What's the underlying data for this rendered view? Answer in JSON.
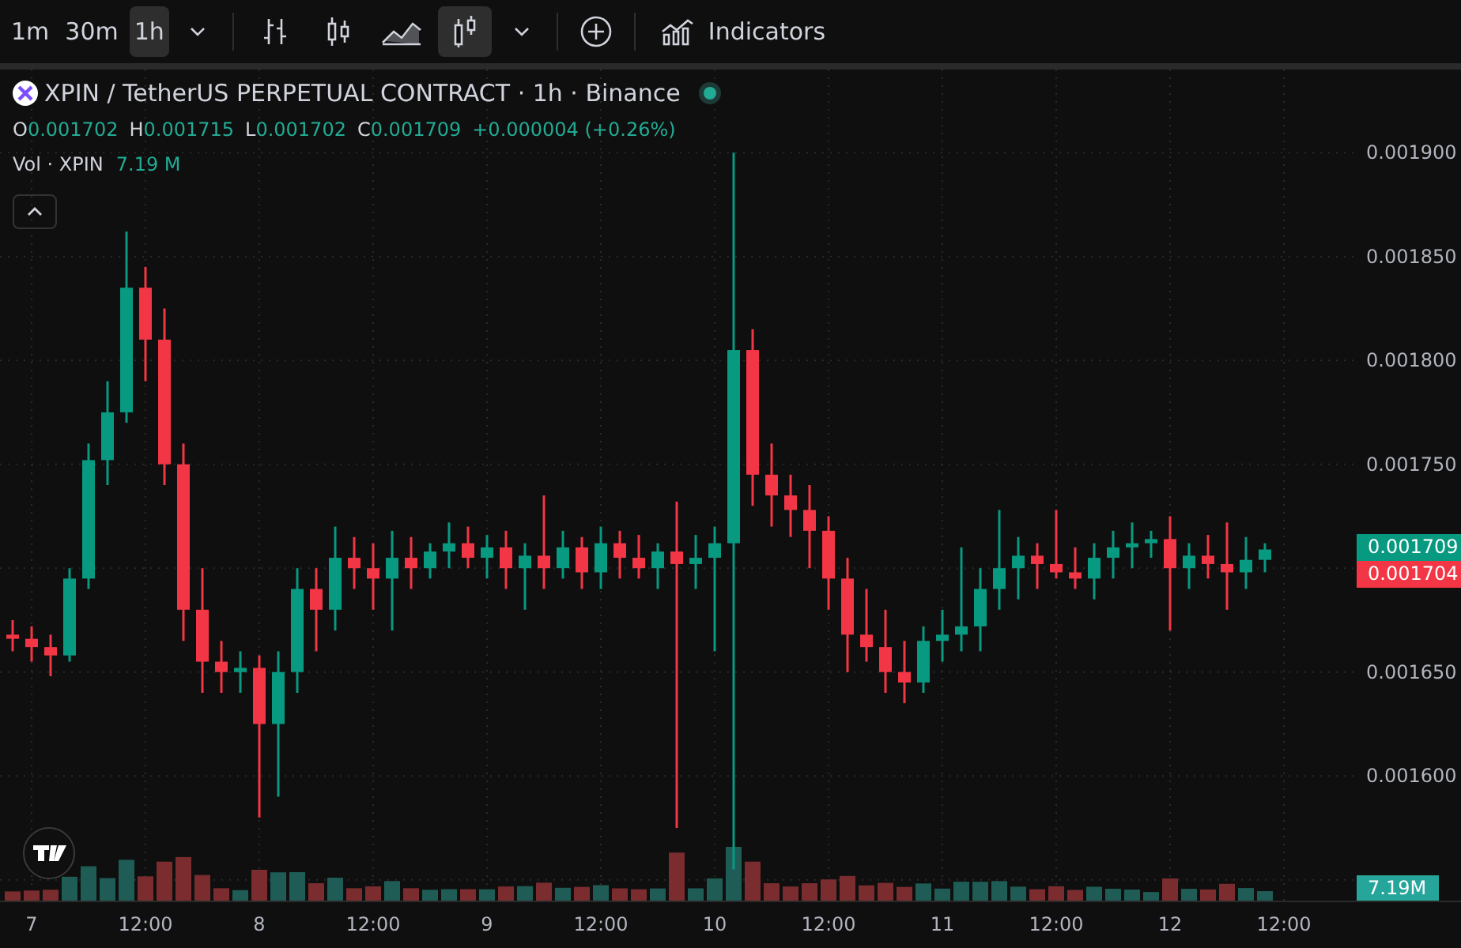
{
  "toolbar": {
    "intervals": [
      {
        "label": "1m",
        "selected": false
      },
      {
        "label": "30m",
        "selected": false
      },
      {
        "label": "1h",
        "selected": true
      }
    ],
    "chart_types": [
      {
        "kind": "bars",
        "selected": false
      },
      {
        "kind": "candles",
        "selected": false
      },
      {
        "kind": "area",
        "selected": false
      },
      {
        "kind": "hollow",
        "selected": true
      }
    ],
    "indicators_label": "Indicators"
  },
  "legend": {
    "title": "XPIN / TetherUS PERPETUAL CONTRACT · 1h · Binance",
    "ohlc": [
      {
        "key": "O",
        "value": "0.001702"
      },
      {
        "key": "H",
        "value": "0.001715"
      },
      {
        "key": "L",
        "value": "0.001702"
      },
      {
        "key": "C",
        "value": "0.001709"
      }
    ],
    "change": "+0.000004 (+0.26%)",
    "volume_label": "Vol · XPIN",
    "volume_value": "7.19 M"
  },
  "price_tags": [
    {
      "label": "0.001709",
      "color": "#089981"
    },
    {
      "label": "0.001704",
      "color": "#f23645"
    }
  ],
  "volume_tag": "7.19M",
  "chart": {
    "chart_data": {
      "type": "candlestick",
      "grid": true,
      "ylim": [
        0.00154,
        0.00194
      ],
      "yticks": [
        {
          "value": 0.0019,
          "label": "0.001900"
        },
        {
          "value": 0.00185,
          "label": "0.001850"
        },
        {
          "value": 0.0018,
          "label": "0.001800"
        },
        {
          "value": 0.00175,
          "label": "0.001750"
        },
        {
          "value": 0.00165,
          "label": "0.001650"
        },
        {
          "value": 0.0016,
          "label": "0.001600"
        }
      ],
      "categories": [
        null,
        "7",
        null,
        null,
        null,
        null,
        null,
        "12:00",
        null,
        null,
        null,
        null,
        null,
        "8",
        null,
        null,
        null,
        null,
        null,
        "12:00",
        null,
        null,
        null,
        null,
        null,
        "9",
        null,
        null,
        null,
        null,
        null,
        "12:00",
        null,
        null,
        null,
        null,
        null,
        "10",
        null,
        null,
        null,
        null,
        null,
        "12:00",
        null,
        null,
        null,
        null,
        null,
        "11",
        null,
        null,
        null,
        null,
        null,
        "12:00",
        null,
        null,
        null,
        null,
        null,
        "12",
        null,
        null,
        null,
        null,
        null,
        "12:00"
      ],
      "ohlc": [
        [
          0.001668,
          0.001675,
          0.00166,
          0.001666
        ],
        [
          0.001666,
          0.001672,
          0.001655,
          0.001662
        ],
        [
          0.001662,
          0.001668,
          0.001648,
          0.001658
        ],
        [
          0.001658,
          0.0017,
          0.001655,
          0.001695
        ],
        [
          0.001695,
          0.00176,
          0.00169,
          0.001752
        ],
        [
          0.001752,
          0.00179,
          0.00174,
          0.001775
        ],
        [
          0.001775,
          0.001862,
          0.00177,
          0.001835
        ],
        [
          0.001835,
          0.001845,
          0.00179,
          0.00181
        ],
        [
          0.00181,
          0.001825,
          0.00174,
          0.00175
        ],
        [
          0.00175,
          0.00176,
          0.001665,
          0.00168
        ],
        [
          0.00168,
          0.0017,
          0.00164,
          0.001655
        ],
        [
          0.001655,
          0.001665,
          0.00164,
          0.00165
        ],
        [
          0.00165,
          0.00166,
          0.00164,
          0.001652
        ],
        [
          0.001652,
          0.001658,
          0.00158,
          0.001625
        ],
        [
          0.001625,
          0.00166,
          0.00159,
          0.00165
        ],
        [
          0.00165,
          0.0017,
          0.00164,
          0.00169
        ],
        [
          0.00169,
          0.0017,
          0.00166,
          0.00168
        ],
        [
          0.00168,
          0.00172,
          0.00167,
          0.001705
        ],
        [
          0.001705,
          0.001715,
          0.00169,
          0.0017
        ],
        [
          0.0017,
          0.001712,
          0.00168,
          0.001695
        ],
        [
          0.001695,
          0.001718,
          0.00167,
          0.001705
        ],
        [
          0.001705,
          0.001715,
          0.00169,
          0.0017
        ],
        [
          0.0017,
          0.001712,
          0.001695,
          0.001708
        ],
        [
          0.001708,
          0.001722,
          0.0017,
          0.001712
        ],
        [
          0.001712,
          0.00172,
          0.0017,
          0.001705
        ],
        [
          0.001705,
          0.001716,
          0.001695,
          0.00171
        ],
        [
          0.00171,
          0.001718,
          0.00169,
          0.0017
        ],
        [
          0.0017,
          0.001712,
          0.00168,
          0.001706
        ],
        [
          0.001706,
          0.001735,
          0.00169,
          0.0017
        ],
        [
          0.0017,
          0.001718,
          0.001695,
          0.00171
        ],
        [
          0.00171,
          0.001715,
          0.00169,
          0.001698
        ],
        [
          0.001698,
          0.00172,
          0.00169,
          0.001712
        ],
        [
          0.001712,
          0.001718,
          0.001695,
          0.001705
        ],
        [
          0.001705,
          0.001716,
          0.001695,
          0.0017
        ],
        [
          0.0017,
          0.001712,
          0.00169,
          0.001708
        ],
        [
          0.001708,
          0.001732,
          0.001575,
          0.001702
        ],
        [
          0.001702,
          0.001716,
          0.00169,
          0.001705
        ],
        [
          0.001705,
          0.00172,
          0.00166,
          0.001712
        ],
        [
          0.001712,
          0.0019,
          0.001555,
          0.001805
        ],
        [
          0.001805,
          0.001815,
          0.00173,
          0.001745
        ],
        [
          0.001745,
          0.00176,
          0.00172,
          0.001735
        ],
        [
          0.001735,
          0.001745,
          0.001715,
          0.001728
        ],
        [
          0.001728,
          0.00174,
          0.0017,
          0.001718
        ],
        [
          0.001718,
          0.001725,
          0.00168,
          0.001695
        ],
        [
          0.001695,
          0.001705,
          0.00165,
          0.001668
        ],
        [
          0.001668,
          0.00169,
          0.001655,
          0.001662
        ],
        [
          0.001662,
          0.00168,
          0.00164,
          0.00165
        ],
        [
          0.00165,
          0.001665,
          0.001635,
          0.001645
        ],
        [
          0.001645,
          0.001672,
          0.00164,
          0.001665
        ],
        [
          0.001665,
          0.00168,
          0.001655,
          0.001668
        ],
        [
          0.001668,
          0.00171,
          0.00166,
          0.001672
        ],
        [
          0.001672,
          0.0017,
          0.00166,
          0.00169
        ],
        [
          0.00169,
          0.001728,
          0.00168,
          0.0017
        ],
        [
          0.0017,
          0.001715,
          0.001685,
          0.001706
        ],
        [
          0.001706,
          0.001712,
          0.00169,
          0.001702
        ],
        [
          0.001702,
          0.001728,
          0.001695,
          0.001698
        ],
        [
          0.001698,
          0.00171,
          0.00169,
          0.001695
        ],
        [
          0.001695,
          0.001712,
          0.001685,
          0.001705
        ],
        [
          0.001705,
          0.001718,
          0.001695,
          0.00171
        ],
        [
          0.00171,
          0.001722,
          0.0017,
          0.001712
        ],
        [
          0.001712,
          0.001718,
          0.001705,
          0.001714
        ],
        [
          0.001714,
          0.001725,
          0.00167,
          0.0017
        ],
        [
          0.0017,
          0.001712,
          0.00169,
          0.001706
        ],
        [
          0.001706,
          0.001716,
          0.001695,
          0.001702
        ],
        [
          0.001702,
          0.001722,
          0.00168,
          0.001698
        ],
        [
          0.001698,
          0.001715,
          0.00169,
          0.001704
        ],
        [
          0.001704,
          0.001712,
          0.001698,
          0.001709
        ],
        null
      ]
    }
  }
}
